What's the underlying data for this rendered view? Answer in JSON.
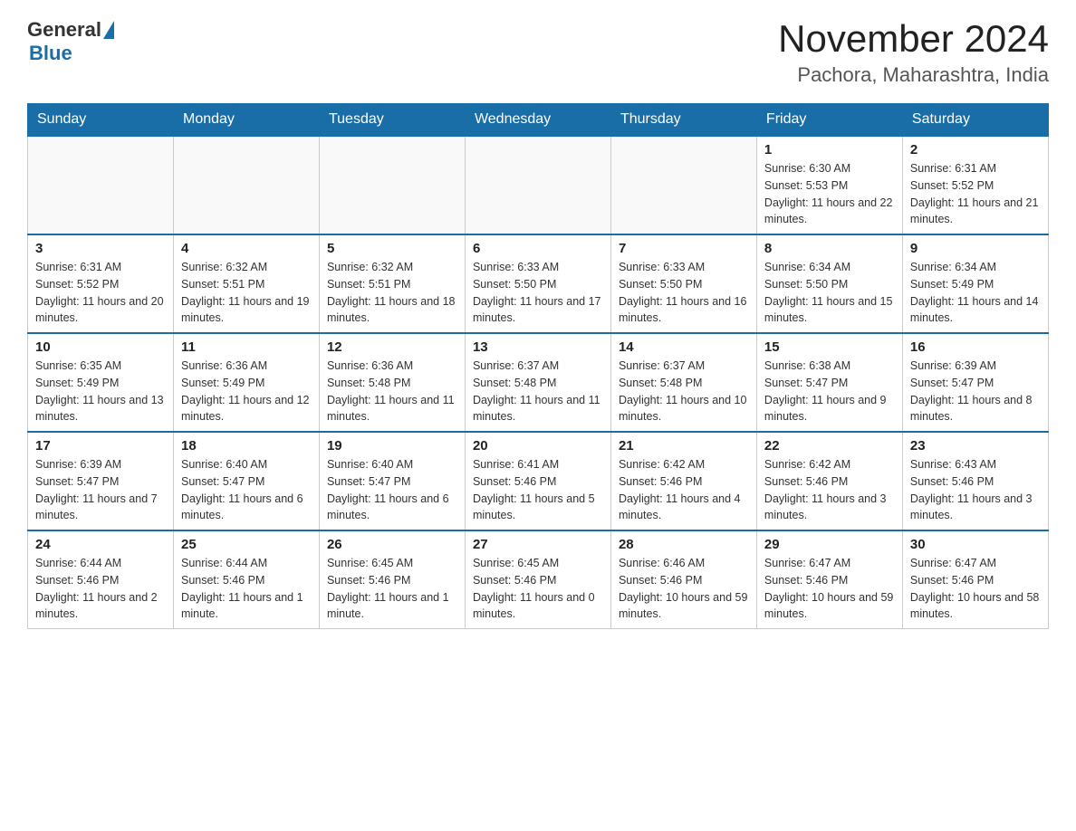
{
  "logo": {
    "general": "General",
    "blue": "Blue"
  },
  "title": "November 2024",
  "subtitle": "Pachora, Maharashtra, India",
  "days_of_week": [
    "Sunday",
    "Monday",
    "Tuesday",
    "Wednesday",
    "Thursday",
    "Friday",
    "Saturday"
  ],
  "weeks": [
    [
      {
        "num": "",
        "sunrise": "",
        "sunset": "",
        "daylight": ""
      },
      {
        "num": "",
        "sunrise": "",
        "sunset": "",
        "daylight": ""
      },
      {
        "num": "",
        "sunrise": "",
        "sunset": "",
        "daylight": ""
      },
      {
        "num": "",
        "sunrise": "",
        "sunset": "",
        "daylight": ""
      },
      {
        "num": "",
        "sunrise": "",
        "sunset": "",
        "daylight": ""
      },
      {
        "num": "1",
        "sunrise": "Sunrise: 6:30 AM",
        "sunset": "Sunset: 5:53 PM",
        "daylight": "Daylight: 11 hours and 22 minutes."
      },
      {
        "num": "2",
        "sunrise": "Sunrise: 6:31 AM",
        "sunset": "Sunset: 5:52 PM",
        "daylight": "Daylight: 11 hours and 21 minutes."
      }
    ],
    [
      {
        "num": "3",
        "sunrise": "Sunrise: 6:31 AM",
        "sunset": "Sunset: 5:52 PM",
        "daylight": "Daylight: 11 hours and 20 minutes."
      },
      {
        "num": "4",
        "sunrise": "Sunrise: 6:32 AM",
        "sunset": "Sunset: 5:51 PM",
        "daylight": "Daylight: 11 hours and 19 minutes."
      },
      {
        "num": "5",
        "sunrise": "Sunrise: 6:32 AM",
        "sunset": "Sunset: 5:51 PM",
        "daylight": "Daylight: 11 hours and 18 minutes."
      },
      {
        "num": "6",
        "sunrise": "Sunrise: 6:33 AM",
        "sunset": "Sunset: 5:50 PM",
        "daylight": "Daylight: 11 hours and 17 minutes."
      },
      {
        "num": "7",
        "sunrise": "Sunrise: 6:33 AM",
        "sunset": "Sunset: 5:50 PM",
        "daylight": "Daylight: 11 hours and 16 minutes."
      },
      {
        "num": "8",
        "sunrise": "Sunrise: 6:34 AM",
        "sunset": "Sunset: 5:50 PM",
        "daylight": "Daylight: 11 hours and 15 minutes."
      },
      {
        "num": "9",
        "sunrise": "Sunrise: 6:34 AM",
        "sunset": "Sunset: 5:49 PM",
        "daylight": "Daylight: 11 hours and 14 minutes."
      }
    ],
    [
      {
        "num": "10",
        "sunrise": "Sunrise: 6:35 AM",
        "sunset": "Sunset: 5:49 PM",
        "daylight": "Daylight: 11 hours and 13 minutes."
      },
      {
        "num": "11",
        "sunrise": "Sunrise: 6:36 AM",
        "sunset": "Sunset: 5:49 PM",
        "daylight": "Daylight: 11 hours and 12 minutes."
      },
      {
        "num": "12",
        "sunrise": "Sunrise: 6:36 AM",
        "sunset": "Sunset: 5:48 PM",
        "daylight": "Daylight: 11 hours and 11 minutes."
      },
      {
        "num": "13",
        "sunrise": "Sunrise: 6:37 AM",
        "sunset": "Sunset: 5:48 PM",
        "daylight": "Daylight: 11 hours and 11 minutes."
      },
      {
        "num": "14",
        "sunrise": "Sunrise: 6:37 AM",
        "sunset": "Sunset: 5:48 PM",
        "daylight": "Daylight: 11 hours and 10 minutes."
      },
      {
        "num": "15",
        "sunrise": "Sunrise: 6:38 AM",
        "sunset": "Sunset: 5:47 PM",
        "daylight": "Daylight: 11 hours and 9 minutes."
      },
      {
        "num": "16",
        "sunrise": "Sunrise: 6:39 AM",
        "sunset": "Sunset: 5:47 PM",
        "daylight": "Daylight: 11 hours and 8 minutes."
      }
    ],
    [
      {
        "num": "17",
        "sunrise": "Sunrise: 6:39 AM",
        "sunset": "Sunset: 5:47 PM",
        "daylight": "Daylight: 11 hours and 7 minutes."
      },
      {
        "num": "18",
        "sunrise": "Sunrise: 6:40 AM",
        "sunset": "Sunset: 5:47 PM",
        "daylight": "Daylight: 11 hours and 6 minutes."
      },
      {
        "num": "19",
        "sunrise": "Sunrise: 6:40 AM",
        "sunset": "Sunset: 5:47 PM",
        "daylight": "Daylight: 11 hours and 6 minutes."
      },
      {
        "num": "20",
        "sunrise": "Sunrise: 6:41 AM",
        "sunset": "Sunset: 5:46 PM",
        "daylight": "Daylight: 11 hours and 5 minutes."
      },
      {
        "num": "21",
        "sunrise": "Sunrise: 6:42 AM",
        "sunset": "Sunset: 5:46 PM",
        "daylight": "Daylight: 11 hours and 4 minutes."
      },
      {
        "num": "22",
        "sunrise": "Sunrise: 6:42 AM",
        "sunset": "Sunset: 5:46 PM",
        "daylight": "Daylight: 11 hours and 3 minutes."
      },
      {
        "num": "23",
        "sunrise": "Sunrise: 6:43 AM",
        "sunset": "Sunset: 5:46 PM",
        "daylight": "Daylight: 11 hours and 3 minutes."
      }
    ],
    [
      {
        "num": "24",
        "sunrise": "Sunrise: 6:44 AM",
        "sunset": "Sunset: 5:46 PM",
        "daylight": "Daylight: 11 hours and 2 minutes."
      },
      {
        "num": "25",
        "sunrise": "Sunrise: 6:44 AM",
        "sunset": "Sunset: 5:46 PM",
        "daylight": "Daylight: 11 hours and 1 minute."
      },
      {
        "num": "26",
        "sunrise": "Sunrise: 6:45 AM",
        "sunset": "Sunset: 5:46 PM",
        "daylight": "Daylight: 11 hours and 1 minute."
      },
      {
        "num": "27",
        "sunrise": "Sunrise: 6:45 AM",
        "sunset": "Sunset: 5:46 PM",
        "daylight": "Daylight: 11 hours and 0 minutes."
      },
      {
        "num": "28",
        "sunrise": "Sunrise: 6:46 AM",
        "sunset": "Sunset: 5:46 PM",
        "daylight": "Daylight: 10 hours and 59 minutes."
      },
      {
        "num": "29",
        "sunrise": "Sunrise: 6:47 AM",
        "sunset": "Sunset: 5:46 PM",
        "daylight": "Daylight: 10 hours and 59 minutes."
      },
      {
        "num": "30",
        "sunrise": "Sunrise: 6:47 AM",
        "sunset": "Sunset: 5:46 PM",
        "daylight": "Daylight: 10 hours and 58 minutes."
      }
    ]
  ]
}
